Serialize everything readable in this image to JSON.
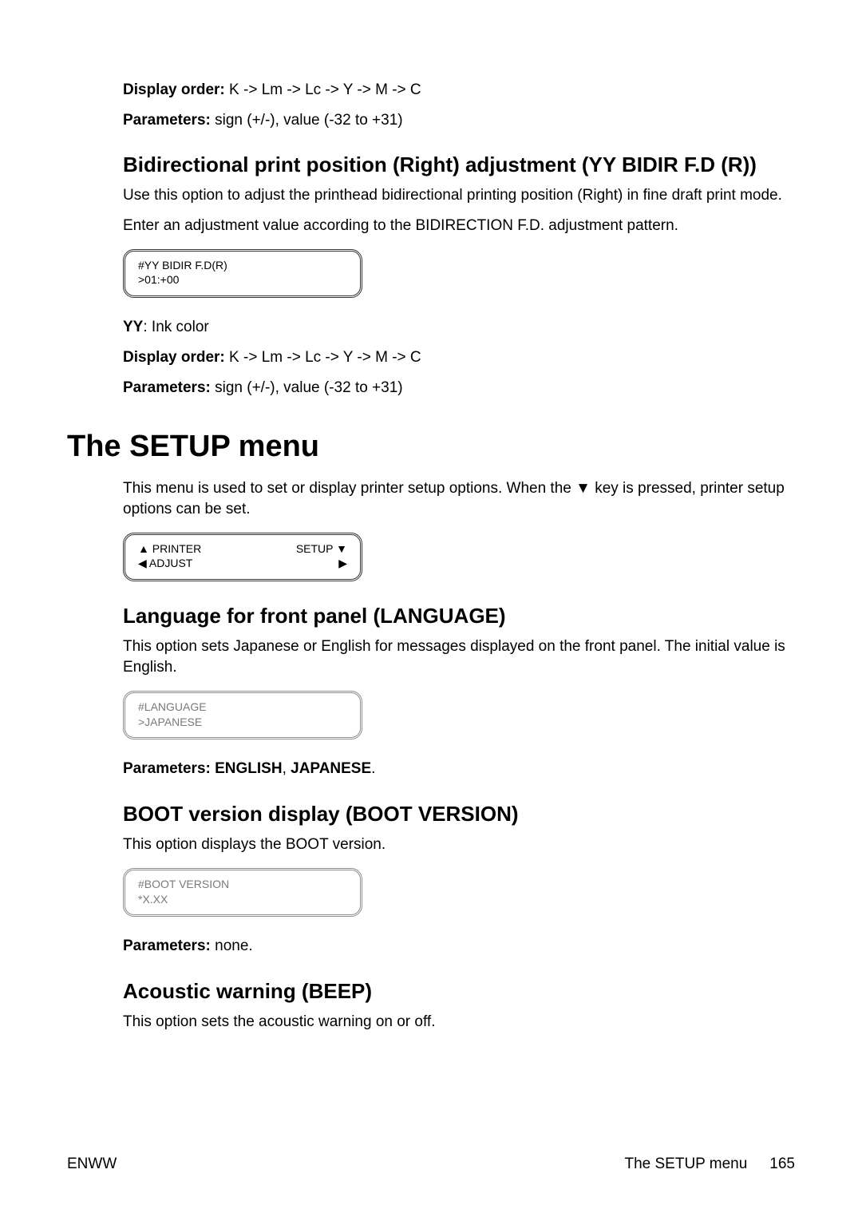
{
  "intro": {
    "display_order_label": "Display order:",
    "display_order_value": " K -> Lm -> Lc -> Y -> M -> C",
    "parameters_label": "Parameters:",
    "parameters_value": " sign (+/-), value (-32 to +31)"
  },
  "bidir": {
    "heading": "Bidirectional print position (Right) adjustment (YY BIDIR F.D (R))",
    "p1": "Use this option to adjust the printhead bidirectional printing position (Right) in fine draft print mode.",
    "p2": "Enter an adjustment value according to the BIDIRECTION F.D. adjustment pattern.",
    "lcd_line1": "#YY BIDIR F.D(R)",
    "lcd_line2": ">01:+00",
    "yy_label": "YY",
    "yy_desc": ": Ink color",
    "display_order_label": "Display order:",
    "display_order_value": " K -> Lm -> Lc -> Y -> M -> C",
    "parameters_label": "Parameters:",
    "parameters_value": " sign (+/-), value (-32 to +31)"
  },
  "setup_menu": {
    "heading": "The SETUP menu",
    "intro": "This menu is used to set or display printer setup options. When the ▼ key is pressed, printer setup options can be set.",
    "lcd": {
      "printer": "▲ PRINTER",
      "setup": "SETUP ▼",
      "adjust": "◀ ADJUST",
      "right": "▶"
    }
  },
  "language": {
    "heading": "Language for front panel (LANGUAGE)",
    "p1": "This option sets Japanese or English for messages displayed on the front panel. The initial value is English.",
    "lcd_line1": "#LANGUAGE",
    "lcd_line2": ">JAPANESE",
    "params_label": "Parameters: ",
    "params_val1": "ENGLISH",
    "params_sep": ", ",
    "params_val2": "JAPANESE",
    "params_end": "."
  },
  "boot": {
    "heading": "BOOT version display (BOOT VERSION)",
    "p1": "This option displays the BOOT version.",
    "lcd_line1": "#BOOT VERSION",
    "lcd_line2": "*X.XX",
    "params_label": "Parameters: ",
    "params_value": "none."
  },
  "beep": {
    "heading": "Acoustic warning (BEEP)",
    "p1": "This option sets the acoustic warning on or off."
  },
  "footer": {
    "left": "ENWW",
    "right_label": "The SETUP menu",
    "page_number": "165"
  }
}
